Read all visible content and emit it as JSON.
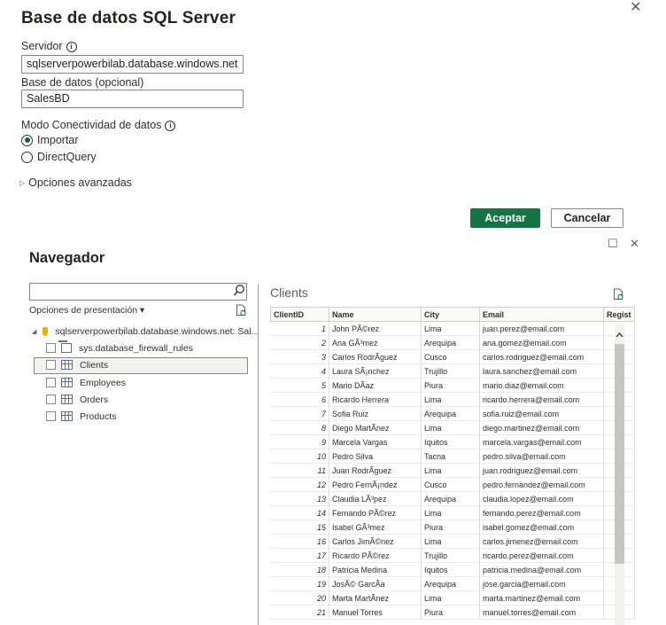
{
  "dialog": {
    "title": "Base de datos SQL Server",
    "close_glyph": "✕",
    "server_label": "Servidor",
    "server_value": "sqlserverpowerbilab.database.windows.net",
    "database_label": "Base de datos (opcional)",
    "database_value": "SalesBD",
    "connectivity_label": "Modo Conectividad de datos",
    "mode_import": "Importar",
    "mode_directquery": "DirectQuery",
    "selected_mode": "Importar",
    "advanced_label": "Opciones avanzadas",
    "ok_label": "Aceptar",
    "cancel_label": "Cancelar",
    "info_glyph": "i",
    "triangle_glyph": "▷"
  },
  "navigator": {
    "title": "Navegador",
    "maximize_glyph": "☐",
    "close_glyph": "✕",
    "search_placeholder": "",
    "display_options_label": "Opciones de presentación ▾",
    "server_node": "sqlserverpowerbilab.database.windows.net: Sal...",
    "items": [
      {
        "label": "sys.database_firewall_rules",
        "icon": "view-icon"
      },
      {
        "label": "Clients",
        "icon": "table-icon",
        "selected": true
      },
      {
        "label": "Employees",
        "icon": "table-icon"
      },
      {
        "label": "Orders",
        "icon": "table-icon"
      },
      {
        "label": "Products",
        "icon": "table-icon"
      }
    ]
  },
  "preview": {
    "title": "Clients",
    "columns": [
      "ClientID",
      "Name",
      "City",
      "Email",
      "Regist"
    ],
    "rows": [
      [
        "1",
        "John PÃ©rez",
        "Lima",
        "juan.perez@email.com"
      ],
      [
        "2",
        "Ana GÃ³mez",
        "Arequipa",
        "ana.gomez@email.com"
      ],
      [
        "3",
        "Carlos RodrÃ­guez",
        "Cusco",
        "carlos.rodriguez@email.com"
      ],
      [
        "4",
        "Laura SÃ¡nchez",
        "Trujillo",
        "laura.sanchez@email.com"
      ],
      [
        "5",
        "Mario DÃ­az",
        "Piura",
        "mario.diaz@email.com"
      ],
      [
        "6",
        "Ricardo Herrera",
        "Lima",
        "ricardo.herrera@email.com"
      ],
      [
        "7",
        "Sofia Ruiz",
        "Arequipa",
        "sofia.ruiz@email.com"
      ],
      [
        "8",
        "Diego MartÃ­nez",
        "Lima",
        "diego.martinez@email.com"
      ],
      [
        "9",
        "Marcela Vargas",
        "Iquitos",
        "marcela.vargas@email.com"
      ],
      [
        "10",
        "Pedro Silva",
        "Tacna",
        "pedro.silva@email.com"
      ],
      [
        "11",
        "Juan RodrÃ­guez",
        "Lima",
        "juan.rodriguez@email.com"
      ],
      [
        "12",
        "Pedro FernÃ¡ndez",
        "Cusco",
        "pedro.fernandez@email.com"
      ],
      [
        "13",
        "Claudia LÃ³pez",
        "Arequipa",
        "claudia.lopez@email.com"
      ],
      [
        "14",
        "Fernando PÃ©rez",
        "Lima",
        "fernando.perez@email.com"
      ],
      [
        "15",
        "Isabel GÃ³mez",
        "Piura",
        "isabel.gomez@email.com"
      ],
      [
        "16",
        "Carlos JimÃ©nez",
        "Lima",
        "carlos.jimenez@email.com"
      ],
      [
        "17",
        "Ricardo PÃ©rez",
        "Trujillo",
        "ricardo.perez@email.com"
      ],
      [
        "18",
        "Patricia Medina",
        "Iquitos",
        "patricia.medina@email.com"
      ],
      [
        "19",
        "JosÃ© GarcÃ­a",
        "Arequipa",
        "jose.garcia@email.com"
      ],
      [
        "20",
        "Marta MartÃ­nez",
        "Lima",
        "marta.martinez@email.com"
      ],
      [
        "21",
        "Manuel Torres",
        "Piura",
        "manuel.torres@email.com"
      ]
    ]
  },
  "colors": {
    "accent": "#157344",
    "text": "#252423",
    "border": "#8a8886"
  }
}
